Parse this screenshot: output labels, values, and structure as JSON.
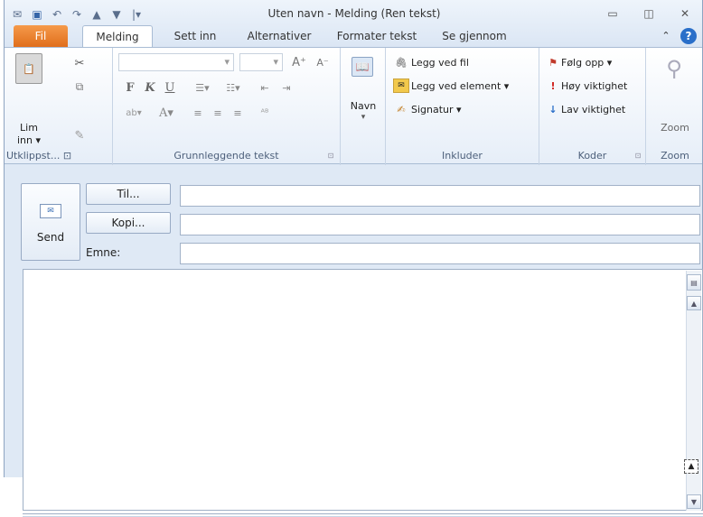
{
  "window": {
    "title": "Uten navn - Melding (Ren tekst)"
  },
  "quick_access": [
    "app-icon",
    "save-icon",
    "undo-icon",
    "redo-icon",
    "up-icon",
    "down-icon",
    "customize-icon"
  ],
  "tabs": [
    {
      "label": "Fil"
    },
    {
      "label": "Melding"
    },
    {
      "label": "Sett inn"
    },
    {
      "label": "Alternativer"
    },
    {
      "label": "Formater tekst"
    },
    {
      "label": "Se gjennom"
    }
  ],
  "ribbon": {
    "clipboard": {
      "paste_label": "Lim",
      "paste_label2": "inn ▾",
      "group_label": "Utklippst... ⊡"
    },
    "basic_text": {
      "group_label": "Grunnleggende tekst",
      "bold": "F",
      "italic": "K",
      "underline": "U"
    },
    "names": {
      "label": "Navn",
      "arrow": "▾"
    },
    "include": {
      "attach_file": "Legg ved fil",
      "attach_item": "Legg ved element ▾",
      "signature": "Signatur ▾",
      "group_label": "Inkluder"
    },
    "tags": {
      "follow_up": "Følg opp ▾",
      "high": "Høy viktighet",
      "low": "Lav viktighet",
      "group_label": "Koder"
    },
    "zoom": {
      "label": "Zoom",
      "group_label": "Zoom"
    }
  },
  "compose": {
    "send_label": "Send",
    "to_label": "Til...",
    "cc_label": "Kopi...",
    "subject_label": "Emne:",
    "to_value": "",
    "cc_value": "",
    "subject_value": "",
    "body_value": ""
  },
  "colors": {
    "file_tab": "#e06e1c",
    "accent": "#2a6fc9"
  }
}
